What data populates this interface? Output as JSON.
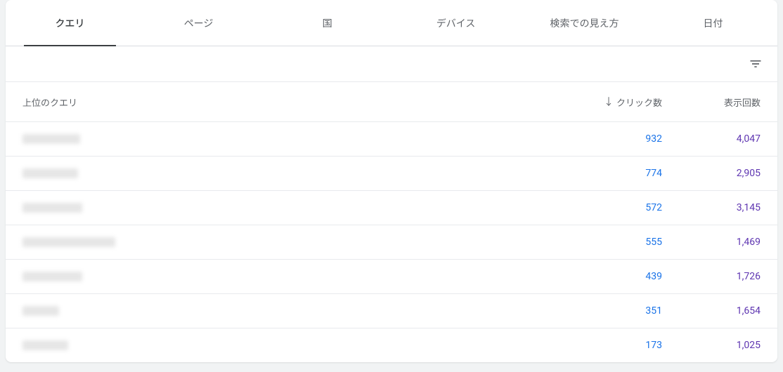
{
  "tabs": [
    {
      "label": "クエリ",
      "active": true
    },
    {
      "label": "ページ",
      "active": false
    },
    {
      "label": "国",
      "active": false
    },
    {
      "label": "デバイス",
      "active": false
    },
    {
      "label": "検索での見え方",
      "active": false
    },
    {
      "label": "日付",
      "active": false
    }
  ],
  "table": {
    "headers": {
      "query": "上位のクエリ",
      "clicks": "クリック数",
      "impressions": "表示回数"
    },
    "rows": [
      {
        "query_width": 82,
        "clicks": "932",
        "impressions": "4,047"
      },
      {
        "query_width": 79,
        "clicks": "774",
        "impressions": "2,905"
      },
      {
        "query_width": 85,
        "clicks": "572",
        "impressions": "3,145"
      },
      {
        "query_width": 132,
        "clicks": "555",
        "impressions": "1,469"
      },
      {
        "query_width": 85,
        "clicks": "439",
        "impressions": "1,726"
      },
      {
        "query_width": 52,
        "clicks": "351",
        "impressions": "1,654"
      },
      {
        "query_width": 65,
        "clicks": "173",
        "impressions": "1,025"
      }
    ]
  }
}
